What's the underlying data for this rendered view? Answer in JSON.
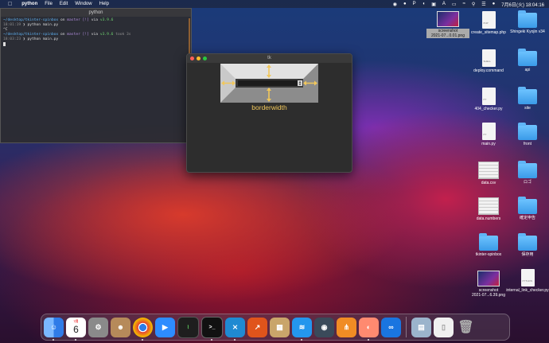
{
  "menubar": {
    "app": "python",
    "items": [
      "File",
      "Edit",
      "Window",
      "Help"
    ],
    "datetime": "7月6日(火)  18:04:16"
  },
  "terminal": {
    "title": "python",
    "line1": {
      "path": "~/desktop/tkinter-spinbox",
      "on": "on",
      "git": "master [!]",
      "via": "via",
      "ver": "v3.9.6"
    },
    "line2": {
      "time": "18:01:19",
      "cmd": "❯ python main.py"
    },
    "line3": "^C",
    "line4": {
      "path": "~/desktop/tkinter-spinbox",
      "on": "on",
      "git": "master [!]",
      "via": "via",
      "ver": "v3.9.6",
      "took": "took 3s"
    },
    "line5": {
      "time": "18:03:23",
      "cmd": "❯ python main.py"
    }
  },
  "tk_window": {
    "title": "tk",
    "label": "borderwidth"
  },
  "desktop": {
    "icons": [
      {
        "label": "screenshot\n2021-07...0.01.png",
        "kind": "shot"
      },
      {
        "label": "create_sitemap.php",
        "kind": "doc",
        "doctext": "PHP"
      },
      {
        "label": "Shingeki Kyojin v34",
        "kind": "folder"
      },
      {
        "label": "deploy.command",
        "kind": "doc",
        "doctext": "SHELL"
      },
      {
        "label": "api",
        "kind": "folder"
      },
      {
        "label": "404_checker.py",
        "kind": "doc",
        "doctext": "PY"
      },
      {
        "label": "site",
        "kind": "folder"
      },
      {
        "label": "main.py",
        "kind": "doc",
        "doctext": "PY"
      },
      {
        "label": "front",
        "kind": "folder"
      },
      {
        "label": "data.csv",
        "kind": "sheet"
      },
      {
        "label": "ロゴ",
        "kind": "folder"
      },
      {
        "label": "data.numbers",
        "kind": "sheet"
      },
      {
        "label": "確定申告",
        "kind": "folder"
      },
      {
        "label": "tkinter-spinbox",
        "kind": "folder"
      },
      {
        "label": "保存用",
        "kind": "folder"
      },
      {
        "label": "screenshot\n2021-07...6.39.png",
        "kind": "shot"
      },
      {
        "label": "internal_link_checker.py",
        "kind": "doc",
        "doctext": "PYTHON"
      }
    ]
  },
  "dock": {
    "calendar": {
      "month": "7月",
      "day": "6"
    },
    "apps": [
      {
        "name": "finder-icon",
        "color": "#3d8af7"
      },
      {
        "name": "calendar-icon",
        "color": "#ffffff"
      },
      {
        "name": "system-preferences-icon",
        "color": "#8a8a8a"
      },
      {
        "name": "contacts-icon",
        "color": "#b68a5a"
      },
      {
        "name": "chrome-icon",
        "color": "#e8e8e8"
      },
      {
        "name": "zoom-icon",
        "color": "#2d8cff"
      },
      {
        "name": "activity-monitor-icon",
        "color": "#1e1e1e"
      },
      {
        "name": "terminal-icon",
        "color": "#111111"
      },
      {
        "name": "vscode-icon",
        "color": "#1f8ad2"
      },
      {
        "name": "graph-app-icon",
        "color": "#e0541b"
      },
      {
        "name": "archive-utility-icon",
        "color": "#c9a56a"
      },
      {
        "name": "docker-icon",
        "color": "#2496ed"
      },
      {
        "name": "proxyman-icon",
        "color": "#3a4a5a"
      },
      {
        "name": "network-diagram-icon",
        "color": "#f08c24"
      },
      {
        "name": "sticky-app-icon",
        "color": "#ff8a70"
      },
      {
        "name": "infinity-app-icon",
        "color": "#1a75e0"
      },
      {
        "name": "preview-icon",
        "color": "#9bb4cc"
      },
      {
        "name": "document-icon",
        "color": "#f0f0f0"
      },
      {
        "name": "trash-icon",
        "color": "#7a7a7a"
      }
    ]
  },
  "colors": {
    "accent_yellow": "#f1c75b",
    "terminal_blue": "#5fb3f5"
  }
}
